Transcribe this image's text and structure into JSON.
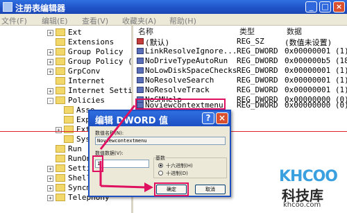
{
  "window": {
    "title": "注册表编辑器"
  },
  "menu": [
    "文件(F)",
    "编辑(E)",
    "查看(V)",
    "收藏夹(A)",
    "帮助(H)"
  ],
  "tree": {
    "items": [
      {
        "label": "Ext",
        "expander": "+"
      },
      {
        "label": "Extensions",
        "expander": ""
      },
      {
        "label": "Group Policy",
        "expander": "+"
      },
      {
        "label": "Group Policy (",
        "expander": "+"
      },
      {
        "label": "GrpConv",
        "expander": "+"
      },
      {
        "label": "Internet",
        "expander": ""
      },
      {
        "label": "Internet Setti",
        "expander": "+"
      },
      {
        "label": "Policies",
        "expander": "-"
      },
      {
        "label": "Asso",
        "expander": ""
      },
      {
        "label": "Expl",
        "expander": ""
      },
      {
        "label": "Ext",
        "expander": "+"
      },
      {
        "label": "Syst",
        "expander": ""
      },
      {
        "label": "Run",
        "expander": ""
      },
      {
        "label": "RunOnce",
        "expander": ""
      },
      {
        "label": "Settings",
        "expander": "+"
      },
      {
        "label": "Shell E",
        "expander": "+"
      },
      {
        "label": "Syncmg",
        "expander": "+"
      },
      {
        "label": "Telephony",
        "expander": "+"
      }
    ]
  },
  "list": {
    "headers": [
      "名称",
      "类型",
      "数据"
    ],
    "rows": [
      {
        "name": "(默认)",
        "type": "REG_SZ",
        "data": "(数值未设置)"
      },
      {
        "name": "LinkResolveIgnore...",
        "type": "REG_DWORD",
        "data": "0x00000001 (1)"
      },
      {
        "name": "NoDriveTypeAutoRun",
        "type": "REG_DWORD",
        "data": "0x000000b5 (18"
      },
      {
        "name": "NoLowDiskSpaceChecks",
        "type": "REG_DWORD",
        "data": "0x00000001 (1)"
      },
      {
        "name": "NoResolveSearch",
        "type": "REG_DWORD",
        "data": "0x00000001 (1)"
      },
      {
        "name": "NoResolveTrack",
        "type": "REG_DWORD",
        "data": "0x00000001 (1)"
      },
      {
        "name": "NoSMHelp",
        "type": "REG_DWORD",
        "data": "0x00000000 (0)"
      },
      {
        "name": "Noviewcontextmenu",
        "type": "REG_DWORD",
        "data": "0x00000000 (0)"
      }
    ]
  },
  "dialog": {
    "title": "编辑 DWORD 值",
    "value_name_label": "数值名称(N):",
    "value_name": "Noviewcontextmenu",
    "value_data_label": "数值数据(V):",
    "value_data": "1",
    "base_label": "基数",
    "hex_label": "十六进制(H)",
    "dec_label": "十进制(D)",
    "ok_label": "确定",
    "cancel_label": "取消"
  },
  "watermark": {
    "logo": "KHCOO",
    "name": "科技库",
    "url": "khcoo.com"
  }
}
